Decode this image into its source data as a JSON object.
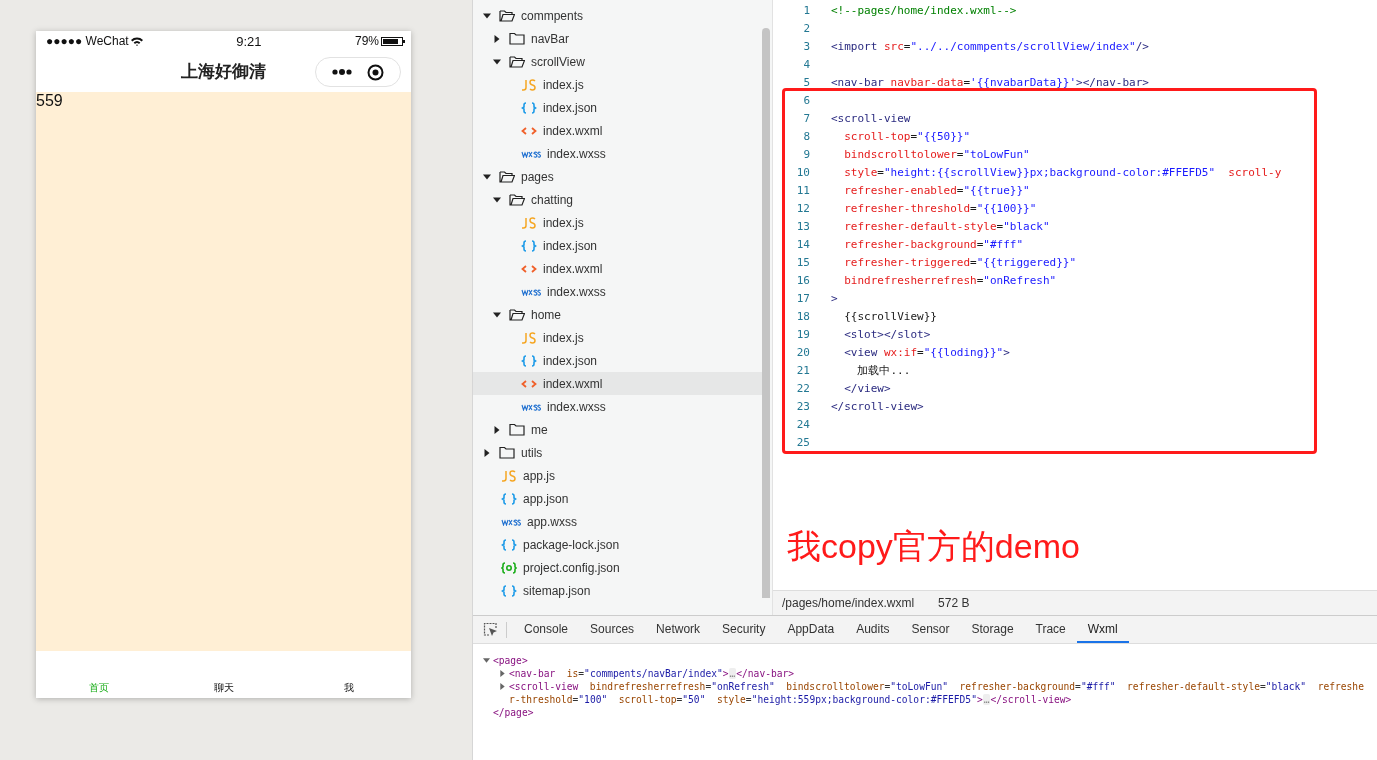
{
  "simulator": {
    "status_bar": {
      "carrier": "●●●●● WeChat",
      "time": "9:21",
      "battery": "79%"
    },
    "nav_bar": {
      "title": "上海好御清"
    },
    "content": {
      "text": "559"
    },
    "tab_bar": [
      {
        "label": "首页",
        "selected": true
      },
      {
        "label": "聊天",
        "selected": false
      },
      {
        "label": "我",
        "selected": false
      }
    ]
  },
  "file_tree": [
    {
      "kind": "folder",
      "name": "commpents",
      "expanded": true,
      "children": [
        {
          "kind": "folder",
          "name": "navBar",
          "expanded": false
        },
        {
          "kind": "folder",
          "name": "scrollView",
          "expanded": true,
          "children": [
            {
              "kind": "js",
              "name": "index.js",
              "selected": false
            },
            {
              "kind": "json",
              "name": "index.json",
              "selected": false
            },
            {
              "kind": "wxml",
              "name": "index.wxml",
              "selected": false
            },
            {
              "kind": "wxss",
              "name": "index.wxss",
              "selected": false
            }
          ]
        }
      ]
    },
    {
      "kind": "folder",
      "name": "pages",
      "expanded": true,
      "children": [
        {
          "kind": "folder",
          "name": "chatting",
          "expanded": true,
          "children": [
            {
              "kind": "js",
              "name": "index.js",
              "selected": false
            },
            {
              "kind": "json",
              "name": "index.json",
              "selected": false
            },
            {
              "kind": "wxml",
              "name": "index.wxml",
              "selected": false
            },
            {
              "kind": "wxss",
              "name": "index.wxss",
              "selected": false
            }
          ]
        },
        {
          "kind": "folder",
          "name": "home",
          "expanded": true,
          "children": [
            {
              "kind": "js",
              "name": "index.js",
              "selected": false
            },
            {
              "kind": "json",
              "name": "index.json",
              "selected": false
            },
            {
              "kind": "wxml",
              "name": "index.wxml",
              "selected": true
            },
            {
              "kind": "wxss",
              "name": "index.wxss",
              "selected": false
            }
          ]
        },
        {
          "kind": "folder",
          "name": "me",
          "expanded": false
        }
      ]
    },
    {
      "kind": "folder",
      "name": "utils",
      "expanded": false
    },
    {
      "kind": "js",
      "name": "app.js",
      "selected": false
    },
    {
      "kind": "json",
      "name": "app.json",
      "selected": false
    },
    {
      "kind": "wxss",
      "name": "app.wxss",
      "selected": false
    },
    {
      "kind": "json",
      "name": "package-lock.json",
      "selected": false
    },
    {
      "kind": "config",
      "name": "project.config.json",
      "selected": false
    },
    {
      "kind": "json",
      "name": "sitemap.json",
      "selected": false
    }
  ],
  "editor": {
    "blocks": [
      {
        "kind": "plain",
        "lines": [
          {
            "number": "1",
            "tokens": [
              {
                "kind": "comment",
                "text": "<!--pages/home/index.wxml-->"
              }
            ]
          },
          {
            "number": "2"
          },
          {
            "number": "3",
            "tokens": [
              {
                "kind": "tag",
                "text": "<import"
              },
              {
                "kind": "attr",
                "text": " src"
              },
              {
                "kind": "plain",
                "text": "="
              },
              {
                "kind": "string",
                "text": "\"../../commpents/scrollView/index\""
              },
              {
                "kind": "tag",
                "text": "/>"
              }
            ]
          },
          {
            "number": "4"
          },
          {
            "number": "5",
            "tokens": [
              {
                "kind": "tag",
                "text": "<nav-bar"
              },
              {
                "kind": "attr",
                "text": " navbar-data"
              },
              {
                "kind": "plain",
                "text": "="
              },
              {
                "kind": "string",
                "text": "'{{nvabarData}}'"
              },
              {
                "kind": "tag",
                "text": "></nav-bar>"
              }
            ]
          }
        ]
      },
      {
        "kind": "annotated",
        "lines": [
          {
            "number": "6"
          },
          {
            "number": "7",
            "tokens": [
              {
                "kind": "tag",
                "text": "<scroll-view"
              }
            ]
          },
          {
            "number": "8",
            "tokens": [
              {
                "kind": "attr",
                "text": "  scroll-top"
              },
              {
                "kind": "plain",
                "text": "="
              },
              {
                "kind": "string",
                "text": "\"{{50}}\""
              }
            ]
          },
          {
            "number": "9",
            "tokens": [
              {
                "kind": "attr",
                "text": "  bindscrolltolower"
              },
              {
                "kind": "plain",
                "text": "="
              },
              {
                "kind": "string",
                "text": "\"toLowFun\""
              }
            ]
          },
          {
            "number": "10",
            "tokens": [
              {
                "kind": "attr",
                "text": "  style"
              },
              {
                "kind": "plain",
                "text": "="
              },
              {
                "kind": "string",
                "text": "\"height:{{scrollView}}px;background-color:#FFEFD5\""
              },
              {
                "kind": "attr",
                "text": "  scroll-y"
              }
            ]
          },
          {
            "number": "11",
            "tokens": [
              {
                "kind": "attr",
                "text": "  refresher-enabled"
              },
              {
                "kind": "plain",
                "text": "="
              },
              {
                "kind": "string",
                "text": "\"{{true}}\""
              }
            ]
          },
          {
            "number": "12",
            "tokens": [
              {
                "kind": "attr",
                "text": "  refresher-threshold"
              },
              {
                "kind": "plain",
                "text": "="
              },
              {
                "kind": "string",
                "text": "\"{{100}}\""
              }
            ]
          },
          {
            "number": "13",
            "tokens": [
              {
                "kind": "attr",
                "text": "  refresher-default-style"
              },
              {
                "kind": "plain",
                "text": "="
              },
              {
                "kind": "string",
                "text": "\"black\""
              }
            ]
          },
          {
            "number": "14",
            "tokens": [
              {
                "kind": "attr",
                "text": "  refresher-background"
              },
              {
                "kind": "plain",
                "text": "="
              },
              {
                "kind": "string",
                "text": "\"#fff\""
              }
            ]
          },
          {
            "number": "15",
            "tokens": [
              {
                "kind": "attr",
                "text": "  refresher-triggered"
              },
              {
                "kind": "plain",
                "text": "="
              },
              {
                "kind": "string",
                "text": "\"{{triggered}}\""
              }
            ]
          },
          {
            "number": "16",
            "tokens": [
              {
                "kind": "attr",
                "text": "  bindrefresherrefresh"
              },
              {
                "kind": "plain",
                "text": "="
              },
              {
                "kind": "string",
                "text": "\"onRefresh\""
              }
            ]
          },
          {
            "number": "17",
            "tokens": [
              {
                "kind": "tag",
                "text": ">"
              }
            ]
          },
          {
            "number": "18",
            "tokens": [
              {
                "kind": "plain",
                "text": "  {{scrollView}}"
              }
            ]
          },
          {
            "number": "19",
            "tokens": [
              {
                "kind": "tag",
                "text": "  <slot></slot>"
              }
            ]
          },
          {
            "number": "20",
            "tokens": [
              {
                "kind": "tag",
                "text": "  <view"
              },
              {
                "kind": "attr",
                "text": " wx:if"
              },
              {
                "kind": "plain",
                "text": "="
              },
              {
                "kind": "string",
                "text": "\"{{loding}}\""
              },
              {
                "kind": "tag",
                "text": ">"
              }
            ]
          },
          {
            "number": "21",
            "tokens": [
              {
                "kind": "plain",
                "text": "    加载中..."
              }
            ]
          },
          {
            "number": "22",
            "tokens": [
              {
                "kind": "tag",
                "text": "  </view>"
              }
            ]
          },
          {
            "number": "23",
            "tokens": [
              {
                "kind": "tag",
                "text": "</scroll-view>"
              }
            ]
          },
          {
            "number": "24"
          },
          {
            "number": "25"
          }
        ]
      }
    ],
    "annotation": "我copy官方的demo",
    "status_bar": {
      "path": "/pages/home/index.wxml",
      "size": "572 B"
    }
  },
  "devtools": {
    "tabs": [
      {
        "label": "Console",
        "selected": false
      },
      {
        "label": "Sources",
        "selected": false
      },
      {
        "label": "Network",
        "selected": false
      },
      {
        "label": "Security",
        "selected": false
      },
      {
        "label": "AppData",
        "selected": false
      },
      {
        "label": "Audits",
        "selected": false
      },
      {
        "label": "Sensor",
        "selected": false
      },
      {
        "label": "Storage",
        "selected": false
      },
      {
        "label": "Trace",
        "selected": false
      },
      {
        "label": "Wxml",
        "selected": true
      }
    ],
    "wxml_tree": [
      {
        "expanded": true,
        "tokens": [
          {
            "kind": "tag",
            "text": "<page>"
          }
        ],
        "children": [
          {
            "expanded": false,
            "tokens": [
              {
                "kind": "tag",
                "text": "<nav-bar"
              },
              {
                "kind": "attr",
                "text": "  is"
              },
              {
                "kind": "plain",
                "text": "="
              },
              {
                "kind": "string",
                "text": "\"commpents/navBar/index\""
              },
              {
                "kind": "tag",
                "text": ">"
              },
              {
                "kind": "ellipsis",
                "text": "…"
              },
              {
                "kind": "tag",
                "text": "</nav-bar>"
              }
            ]
          },
          {
            "expanded": false,
            "tokens": [
              {
                "kind": "tag",
                "text": "<scroll-view"
              },
              {
                "kind": "attr",
                "text": "  bindrefresherrefresh"
              },
              {
                "kind": "plain",
                "text": "="
              },
              {
                "kind": "string",
                "text": "\"onRefresh\""
              },
              {
                "kind": "attr",
                "text": "  bindscrolltolower"
              },
              {
                "kind": "plain",
                "text": "="
              },
              {
                "kind": "string",
                "text": "\"toLowFun\""
              },
              {
                "kind": "attr",
                "text": "  refresher-background"
              },
              {
                "kind": "plain",
                "text": "="
              },
              {
                "kind": "string",
                "text": "\"#fff\""
              },
              {
                "kind": "attr",
                "text": "  refresher-default-style"
              },
              {
                "kind": "plain",
                "text": "="
              },
              {
                "kind": "string",
                "text": "\"black\""
              },
              {
                "kind": "attr",
                "text": "  refresher-threshold"
              },
              {
                "kind": "plain",
                "text": "="
              },
              {
                "kind": "string",
                "text": "\"100\""
              },
              {
                "kind": "attr",
                "text": "  scroll-top"
              },
              {
                "kind": "plain",
                "text": "="
              },
              {
                "kind": "string",
                "text": "\"50\""
              },
              {
                "kind": "attr",
                "text": "  style"
              },
              {
                "kind": "plain",
                "text": "="
              },
              {
                "kind": "string",
                "text": "\"height:559px;background-color:#FFEFD5\""
              },
              {
                "kind": "tag",
                "text": ">"
              },
              {
                "kind": "ellipsis",
                "text": "…"
              },
              {
                "kind": "tag",
                "text": "</scroll-view>"
              }
            ]
          }
        ],
        "closing": [
          {
            "kind": "tag",
            "text": "</page>"
          }
        ]
      }
    ]
  }
}
